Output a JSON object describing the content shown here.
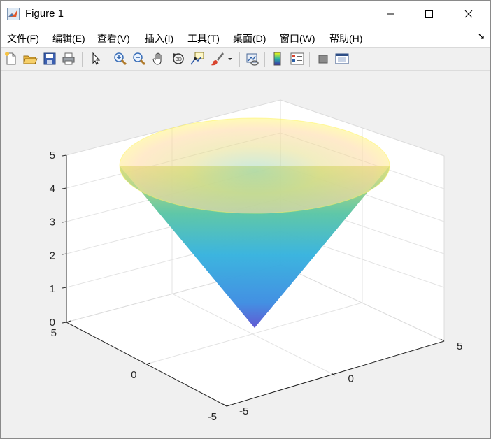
{
  "window": {
    "title": "Figure 1"
  },
  "menu": [
    {
      "label": "文件(F)"
    },
    {
      "label": "编辑(E)"
    },
    {
      "label": "查看(V)"
    },
    {
      "label": "插入(I)"
    },
    {
      "label": "工具(T)"
    },
    {
      "label": "桌面(D)"
    },
    {
      "label": "窗口(W)"
    },
    {
      "label": "帮助(H)"
    }
  ],
  "toolbar": [
    "new-figure-icon",
    "open-file-icon",
    "save-icon",
    "print-icon",
    "edit-plot-arrow-icon",
    "zoom-in-icon",
    "zoom-out-icon",
    "pan-hand-icon",
    "rotate-3d-icon",
    "data-cursor-icon",
    "brush-icon",
    "brush-dropdown-icon",
    "link-plot-icon",
    "colorbar-icon",
    "legend-icon",
    "hide-plot-tools-icon",
    "show-plot-tools-icon"
  ],
  "chart_data": {
    "type": "surface",
    "shape": "cone",
    "equation_hint": "z = sqrt(x^2 + y^2)",
    "colormap": "parula",
    "face_alpha": "semi-transparent",
    "xlim": [
      -5,
      5
    ],
    "ylim": [
      -5,
      5
    ],
    "zlim": [
      0,
      5
    ],
    "x_ticks": [
      "-5",
      "0",
      "5"
    ],
    "y_ticks": [
      "-5",
      "0",
      "5"
    ],
    "z_ticks": [
      "0",
      "1",
      "2",
      "3",
      "4",
      "5"
    ],
    "grid": "on",
    "box": "on",
    "view": "3d-default"
  }
}
